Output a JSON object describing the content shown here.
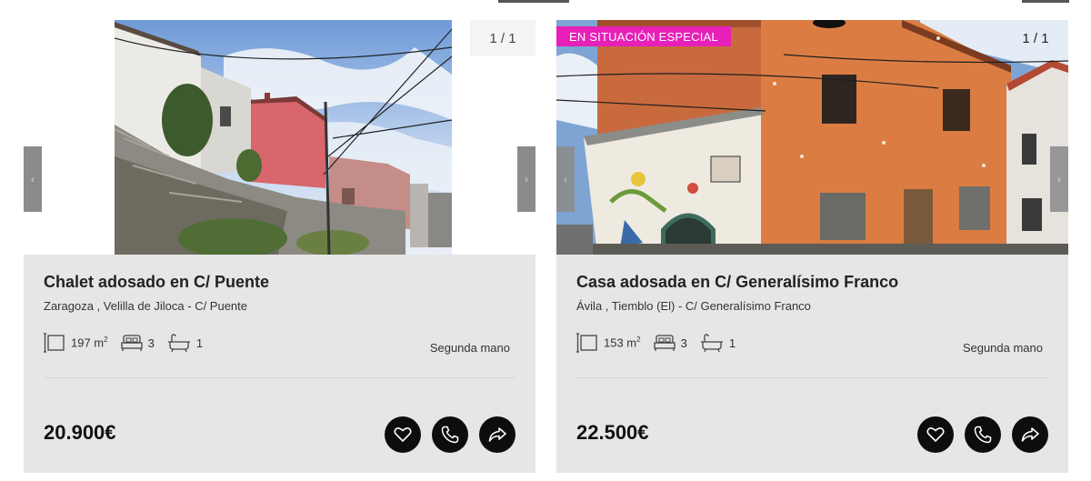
{
  "listings": [
    {
      "title": "Chalet adosado en C/ Puente",
      "location": "Zaragoza , Velilla de Jiloca - C/ Puente",
      "area": "197 m",
      "area_unit_sup": "2",
      "bedrooms": "3",
      "bathrooms": "1",
      "condition": "Segunda mano",
      "price": "20.900€",
      "image_counter": "1 / 1",
      "badge": ""
    },
    {
      "title": "Casa adosada en C/ Generalísimo Franco",
      "location": "Ávila , Tiemblo (El) - C/ Generalísimo Franco",
      "area": "153 m",
      "area_unit_sup": "2",
      "bedrooms": "3",
      "bathrooms": "1",
      "condition": "Segunda mano",
      "price": "22.500€",
      "image_counter": "1 / 1",
      "badge": "EN SITUACIÓN ESPECIAL"
    }
  ],
  "icons": {
    "area": "area-icon",
    "bed": "bed-icon",
    "bath": "bath-icon",
    "favorite": "heart-icon",
    "call": "phone-icon",
    "share": "share-icon",
    "prev": "chevron-left-icon",
    "next": "chevron-right-icon"
  },
  "colors": {
    "badge": "#e620b8",
    "card_bg": "#e6e6e6",
    "action_bg": "#0d0d0d"
  }
}
